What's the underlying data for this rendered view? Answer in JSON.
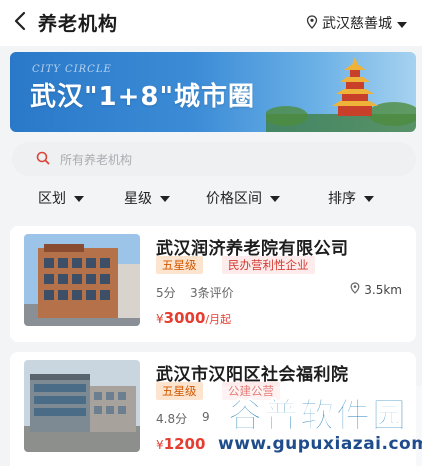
{
  "header": {
    "title": "养老机构",
    "location": "武汉慈善城"
  },
  "banner": {
    "small_text": "CITY CIRCLE",
    "headline": "武汉\"1+8\"城市圈"
  },
  "search": {
    "placeholder": "所有养老机构"
  },
  "filters": [
    {
      "label": "区划"
    },
    {
      "label": "星级"
    },
    {
      "label": "价格区间"
    },
    {
      "label": "排序"
    }
  ],
  "cards": [
    {
      "name": "武汉润济养老院有限公司",
      "star_tag": "五星级",
      "type_tag": "民办营利性企业",
      "score": "5分",
      "reviews": "3条评价",
      "distance": "3.5km",
      "currency": "¥",
      "price": "3000",
      "price_unit": "/月起"
    },
    {
      "name": "武汉市汉阳区社会福利院",
      "star_tag": "五星级",
      "type_tag": "公建公营",
      "score": "4.8分",
      "reviews": "9",
      "currency": "¥",
      "price": "1200"
    }
  ],
  "watermark": {
    "brand": "谷普软件园",
    "url": "www.gupuxiazai.com"
  },
  "colors": {
    "accent_red": "#e53d30",
    "star_orange": "#d35700",
    "banner_blue": "#2a79c9"
  }
}
